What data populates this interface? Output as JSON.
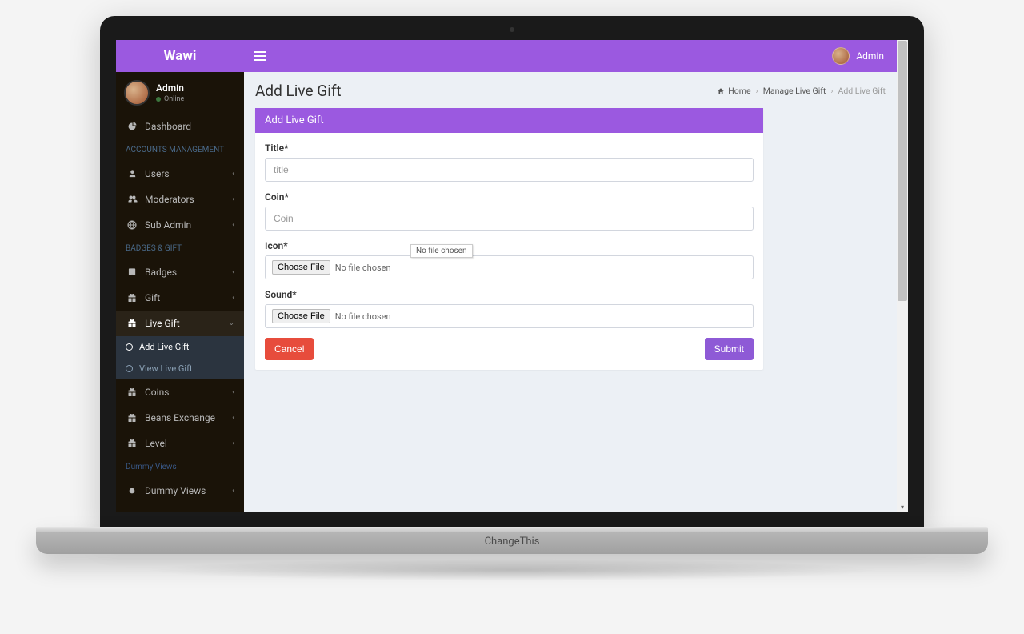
{
  "brand_below": "ChangeThis",
  "app": {
    "logo": "Wawi",
    "top_user": "Admin"
  },
  "user_panel": {
    "name": "Admin",
    "status": "Online"
  },
  "sidebar": {
    "dashboard": "Dashboard",
    "section_accounts": "ACCOUNTS MANAGEMENT",
    "users": "Users",
    "moderators": "Moderators",
    "sub_admin": "Sub Admin",
    "section_badges": "BADGES & GIFT",
    "badges": "Badges",
    "gift": "Gift",
    "live_gift": "Live Gift",
    "add_live_gift": "Add Live Gift",
    "view_live_gift": "View Live Gift",
    "coins": "Coins",
    "beans_exchange": "Beans Exchange",
    "level": "Level",
    "section_dummy": "Dummy Views",
    "dummy_views": "Dummy Views"
  },
  "page": {
    "title": "Add Live Gift",
    "breadcrumb": {
      "home": "Home",
      "mid": "Manage Live Gift",
      "last": "Add Live Gift"
    },
    "card_title": "Add Live Gift"
  },
  "form": {
    "title_label": "Title*",
    "title_placeholder": "title",
    "coin_label": "Coin*",
    "coin_placeholder": "Coin",
    "icon_label": "Icon*",
    "sound_label": "Sound*",
    "choose_file": "Choose File",
    "no_file": "No file chosen",
    "cancel": "Cancel",
    "submit": "Submit"
  },
  "tooltip": "No file chosen"
}
